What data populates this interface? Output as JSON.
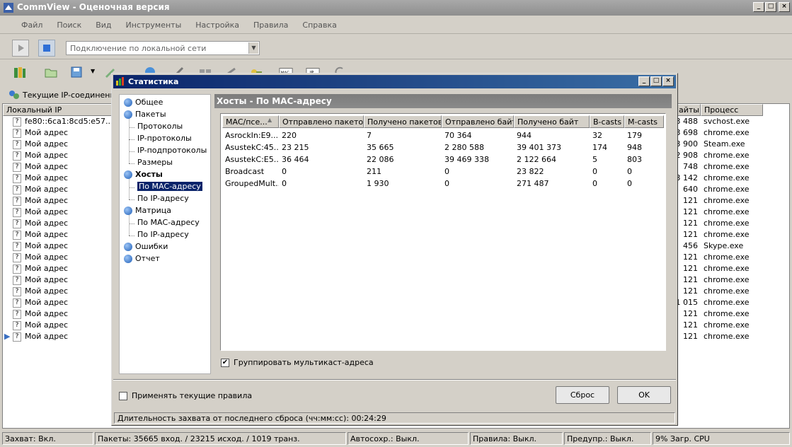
{
  "app": {
    "title": "CommView - Оценочная версия"
  },
  "menu": [
    "Файл",
    "Поиск",
    "Вид",
    "Инструменты",
    "Настройка",
    "Правила",
    "Справка"
  ],
  "adapter": {
    "selected": "Подключение по локальной сети"
  },
  "bg": {
    "tab_label": "Текущие IP-соединения",
    "col_local": "Локальный IP",
    "col_bytes": "айты",
    "col_process": "Процесс",
    "rows": [
      {
        "ip": "fe80::6ca1:8cd5:e57...",
        "bytes": "3 488",
        "proc": "svchost.exe"
      },
      {
        "ip": "Мой адрес",
        "bytes": "3 698",
        "proc": "chrome.exe"
      },
      {
        "ip": "Мой адрес",
        "bytes": "3 900",
        "proc": "Steam.exe"
      },
      {
        "ip": "Мой адрес",
        "bytes": "2 908",
        "proc": "chrome.exe"
      },
      {
        "ip": "Мой адрес",
        "bytes": "748",
        "proc": "chrome.exe"
      },
      {
        "ip": "Мой адрес",
        "bytes": "3 142",
        "proc": "chrome.exe"
      },
      {
        "ip": "Мой адрес",
        "bytes": "640",
        "proc": "chrome.exe"
      },
      {
        "ip": "Мой адрес",
        "bytes": "121",
        "proc": "chrome.exe"
      },
      {
        "ip": "Мой адрес",
        "bytes": "121",
        "proc": "chrome.exe"
      },
      {
        "ip": "Мой адрес",
        "bytes": "121",
        "proc": "chrome.exe"
      },
      {
        "ip": "Мой адрес",
        "bytes": "121",
        "proc": "chrome.exe"
      },
      {
        "ip": "Мой адрес",
        "bytes": "456",
        "proc": "Skype.exe"
      },
      {
        "ip": "Мой адрес",
        "bytes": "121",
        "proc": "chrome.exe"
      },
      {
        "ip": "Мой адрес",
        "bytes": "121",
        "proc": "chrome.exe"
      },
      {
        "ip": "Мой адрес",
        "bytes": "121",
        "proc": "chrome.exe"
      },
      {
        "ip": "Мой адрес",
        "bytes": "121",
        "proc": "chrome.exe"
      },
      {
        "ip": "Мой адрес",
        "bytes": "1 015",
        "proc": "chrome.exe"
      },
      {
        "ip": "Мой адрес",
        "bytes": "121",
        "proc": "chrome.exe"
      },
      {
        "ip": "Мой адрес",
        "bytes": "121",
        "proc": "chrome.exe"
      },
      {
        "ip": "Мой адрес",
        "bytes": "121",
        "proc": "chrome.exe"
      }
    ]
  },
  "dialog": {
    "title": "Статистика",
    "panel_title": "Хосты - По МАС-адресу",
    "tree": [
      {
        "label": "Общее",
        "level": 0
      },
      {
        "label": "Пакеты",
        "level": 0
      },
      {
        "label": "Протоколы",
        "level": 1
      },
      {
        "label": "IP-протоколы",
        "level": 1
      },
      {
        "label": "IP-подпротоколы",
        "level": 1
      },
      {
        "label": "Размеры",
        "level": 1
      },
      {
        "label": "Хосты",
        "level": 0,
        "bold": true
      },
      {
        "label": "По МАС-адресу",
        "level": 1,
        "selected": true
      },
      {
        "label": "По IP-адресу",
        "level": 1
      },
      {
        "label": "Матрица",
        "level": 0
      },
      {
        "label": "По МАС-адресу",
        "level": 1
      },
      {
        "label": "По IP-адресу",
        "level": 1
      },
      {
        "label": "Ошибки",
        "level": 0
      },
      {
        "label": "Отчет",
        "level": 0
      }
    ],
    "columns": [
      "MAC/псе...",
      "Отправлено пакетов",
      "Получено пакетов",
      "Отправлено байт",
      "Получено байт",
      "B-casts",
      "M-casts"
    ],
    "rows": [
      [
        "AsrockIn:E9...",
        "220",
        "7",
        "70 364",
        "944",
        "32",
        "179"
      ],
      [
        "AsustekC:45...",
        "23 215",
        "35 665",
        "2 280 588",
        "39 401 373",
        "174",
        "948"
      ],
      [
        "AsustekC:E5...",
        "36 464",
        "22 086",
        "39 469 338",
        "2 122 664",
        "5",
        "803"
      ],
      [
        "Broadcast",
        "0",
        "211",
        "0",
        "23 822",
        "0",
        "0"
      ],
      [
        "GroupedMult...",
        "0",
        "1 930",
        "0",
        "271 487",
        "0",
        "0"
      ]
    ],
    "group_multicast": "Группировать мультикаст-адреса",
    "apply_rules": "Применять текущие правила",
    "reset": "Сброс",
    "ok": "OK",
    "duration": "Длительность захвата от последнего сброса (чч:мм:сс): 00:24:29"
  },
  "status": [
    "Захват: Вкл.",
    "Пакеты: 35665 вход. / 23215 исход. / 1019 транз.",
    "Автосохр.: Выкл.",
    "Правила: Выкл.",
    "Предупр.: Выкл.",
    "9% Загр. CPU"
  ]
}
